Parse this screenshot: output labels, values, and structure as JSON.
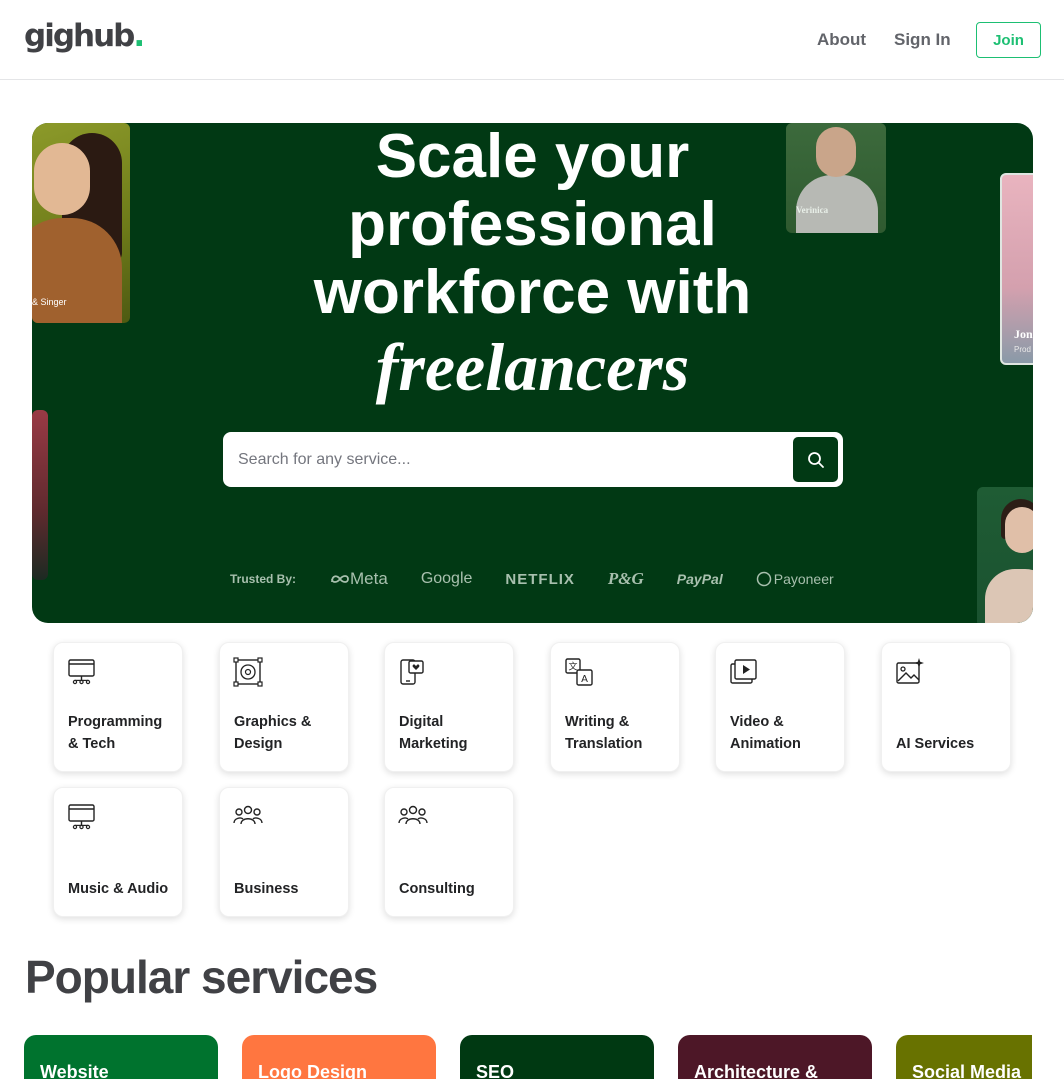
{
  "header": {
    "logo_text": "gighub",
    "logo_dot": ".",
    "nav": {
      "about": "About",
      "sign_in": "Sign In",
      "join": "Join"
    }
  },
  "hero": {
    "title_lines": [
      "Scale your",
      "professional",
      "workforce with"
    ],
    "title_italic": "freelancers",
    "search": {
      "placeholder": "Search for any service..."
    },
    "trusted_label": "Trusted By:",
    "brands": [
      "Meta",
      "Google",
      "NETFLIX",
      "P&G",
      "PayPal",
      "Payoneer"
    ],
    "photo_captions": {
      "card1": "& Singer",
      "card2": "Verinica",
      "card3": "Jon",
      "card3_sub": "Prod"
    }
  },
  "categories": [
    {
      "label": "Programming & Tech",
      "icon": "code-display-icon"
    },
    {
      "label": "Graphics & Design",
      "icon": "design-frame-icon"
    },
    {
      "label": "Digital Marketing",
      "icon": "phone-heart-icon"
    },
    {
      "label": "Writing & Translation",
      "icon": "translate-icon"
    },
    {
      "label": "Video & Animation",
      "icon": "video-play-icon"
    },
    {
      "label": "AI Services",
      "icon": "ai-image-icon"
    },
    {
      "label": "Music & Audio",
      "icon": "monitor-icon"
    },
    {
      "label": "Business",
      "icon": "people-icon"
    },
    {
      "label": "Consulting",
      "icon": "people-icon"
    }
  ],
  "popular": {
    "title": "Popular services",
    "services": [
      {
        "label": "Website",
        "color": "#00732e"
      },
      {
        "label": "Logo Design",
        "color": "#ff7640"
      },
      {
        "label": "SEO",
        "color": "#003912"
      },
      {
        "label": "Architecture &",
        "color": "#4d1727"
      },
      {
        "label": "Social Media",
        "color": "#687200"
      }
    ]
  },
  "colors": {
    "brand_green": "#1dbf73",
    "hero_bg": "#013914",
    "text": "#404145"
  }
}
